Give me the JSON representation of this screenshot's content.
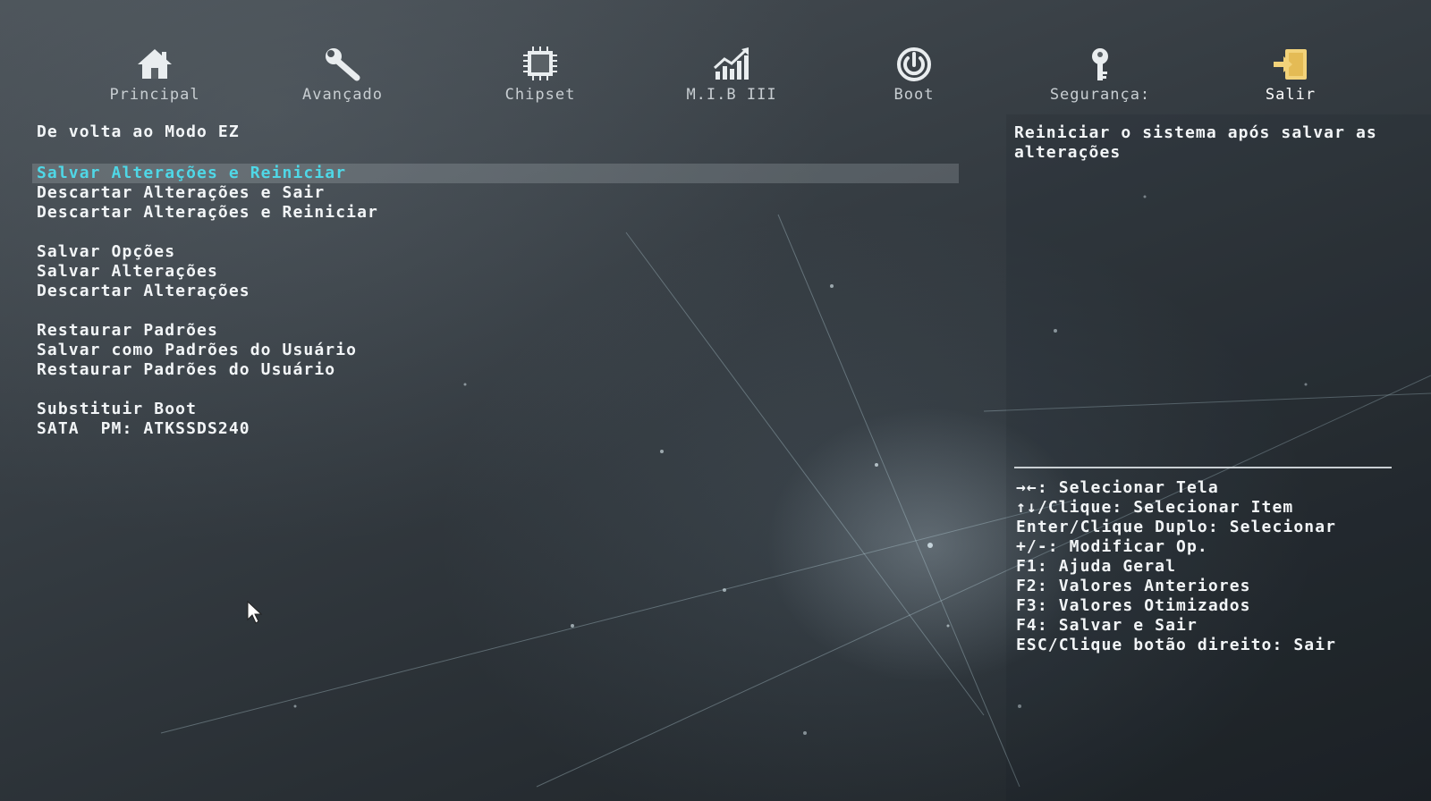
{
  "nav": {
    "tabs": [
      {
        "label": "Principal",
        "icon": "home-icon"
      },
      {
        "label": "Avançado",
        "icon": "wrench-icon"
      },
      {
        "label": "Chipset",
        "icon": "chip-icon"
      },
      {
        "label": "M.I.B III",
        "icon": "chart-icon"
      },
      {
        "label": "Boot",
        "icon": "power-icon"
      },
      {
        "label": "Segurança:",
        "icon": "key-icon"
      },
      {
        "label": "Salir",
        "icon": "exit-icon"
      }
    ],
    "active_tab": "Salir"
  },
  "menu": {
    "back_label": "De volta ao Modo EZ",
    "group1": [
      "Salvar Alterações e Reiniciar",
      "Descartar Alterações e Sair",
      "Descartar Alterações e Reiniciar"
    ],
    "group2": [
      "Salvar Opções",
      "Salvar Alterações",
      "Descartar Alterações"
    ],
    "group3": [
      "Restaurar Padrões",
      "Salvar como Padrões do Usuário",
      "Restaurar Padrões do Usuário"
    ],
    "group4": [
      "Substituir Boot",
      "SATA  PM: ATKSSDS240"
    ],
    "selected": "Salvar Alterações e Reiniciar"
  },
  "help": {
    "description": "Reiniciar o sistema após salvar as alterações",
    "keys": [
      "→←: Selecionar Tela",
      "↑↓/Clique: Selecionar Item",
      "Enter/Clique Duplo: Selecionar",
      "+/-: Modificar Op.",
      "F1: Ajuda Geral",
      "F2: Valores Anteriores",
      "F3: Valores Otimizados",
      "F4: Salvar e Sair",
      "ESC/Clique botão direito: Sair"
    ]
  },
  "colors": {
    "highlight_text": "#4fd7e6",
    "exit_icon": "#f2d27a",
    "text": "#f2f5f7"
  }
}
